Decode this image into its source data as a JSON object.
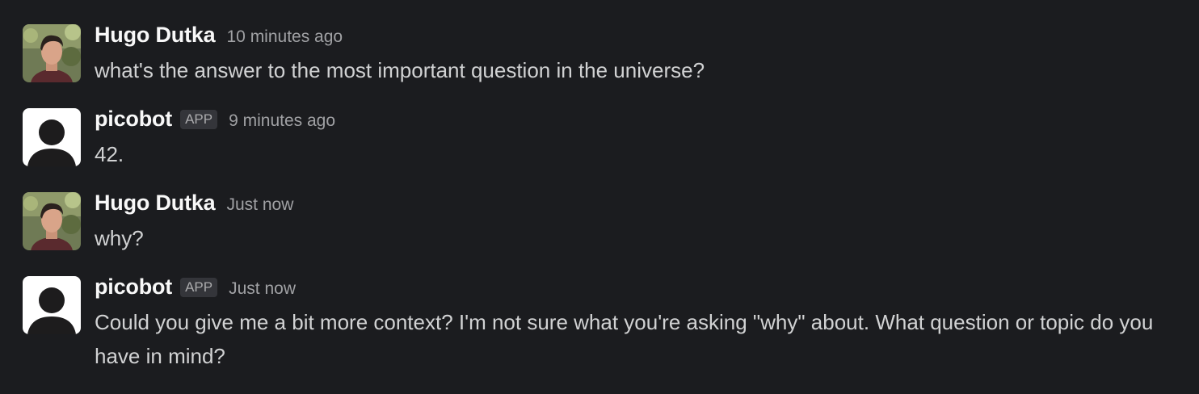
{
  "messages": [
    {
      "author": "Hugo Dutka",
      "avatar": "user-photo",
      "timestamp": "10 minutes ago",
      "badge": "",
      "text": "what's the answer to the most important question in the universe?"
    },
    {
      "author": "picobot",
      "avatar": "default-user-silhouette",
      "timestamp": "9 minutes ago",
      "badge": "APP",
      "text": "42."
    },
    {
      "author": "Hugo Dutka",
      "avatar": "user-photo",
      "timestamp": "Just now",
      "badge": "",
      "text": "why?"
    },
    {
      "author": "picobot",
      "avatar": "default-user-silhouette",
      "timestamp": "Just now",
      "badge": "APP",
      "text": "Could you give me a bit more context? I'm not sure what you're asking \"why\" about. What question or topic do you have in mind?"
    }
  ],
  "colors": {
    "background": "#1b1c1f",
    "author": "#f8f8f8",
    "text": "#d1d2d3",
    "timestamp": "#a0a1a4",
    "badge_bg": "#34353a"
  }
}
